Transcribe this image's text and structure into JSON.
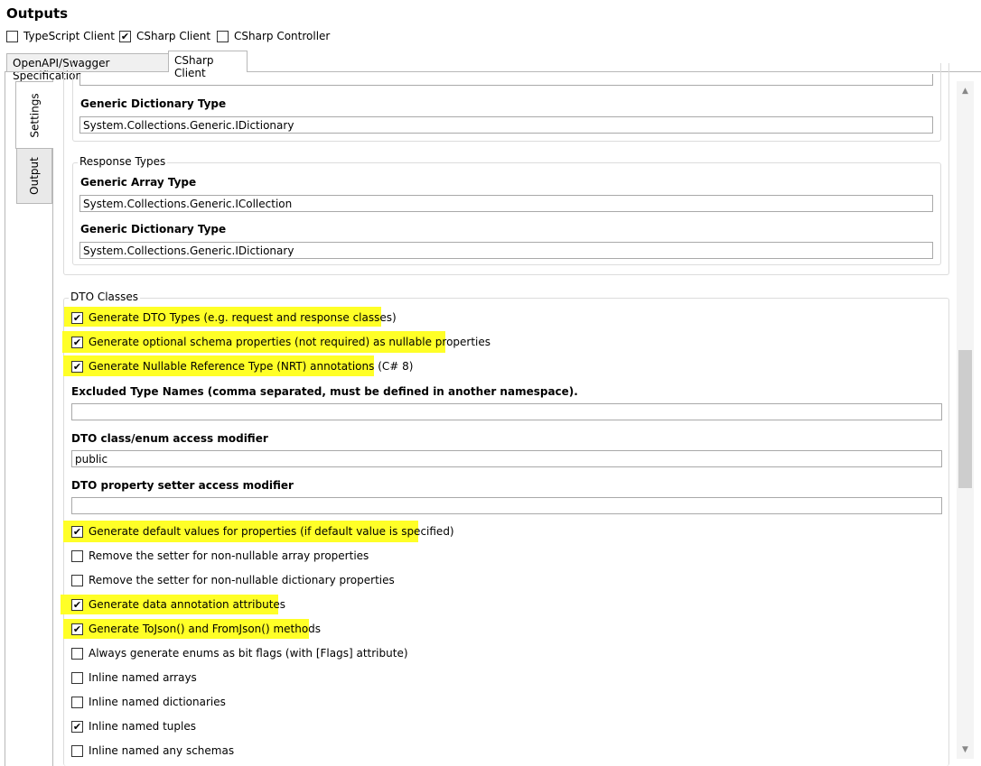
{
  "header": {
    "title": "Outputs",
    "outputs": [
      {
        "label": "TypeScript Client",
        "checked": false
      },
      {
        "label": "CSharp Client",
        "checked": true
      },
      {
        "label": "CSharp Controller",
        "checked": false
      }
    ]
  },
  "tabs": {
    "spec": "OpenAPI/Swagger Specification",
    "client": "CSharp Client",
    "active": "CSharp Client"
  },
  "side_tabs": {
    "settings": "Settings",
    "output": "Output",
    "active": "Settings"
  },
  "request_group": {
    "dict_label": "Generic Dictionary Type",
    "dict_value": "System.Collections.Generic.IDictionary"
  },
  "response_group": {
    "legend": "Response Types",
    "array_label": "Generic Array Type",
    "array_value": "System.Collections.Generic.ICollection",
    "dict_label": "Generic Dictionary Type",
    "dict_value": "System.Collections.Generic.IDictionary"
  },
  "dto": {
    "legend": "DTO Classes",
    "options_top": [
      {
        "label": "Generate DTO Types (e.g. request and response classes)",
        "checked": true,
        "highlighted": true
      },
      {
        "label": "Generate optional schema properties (not required) as nullable properties",
        "checked": true,
        "highlighted": true
      },
      {
        "label": "Generate Nullable Reference Type (NRT) annotations (C# 8)",
        "checked": true,
        "highlighted": true
      }
    ],
    "excluded_label": "Excluded Type Names (comma separated, must be defined in another namespace).",
    "excluded_value": "",
    "access_label": "DTO class/enum access modifier",
    "access_value": "public",
    "setter_label": "DTO property setter access modifier",
    "setter_value": "",
    "options_bottom": [
      {
        "label": "Generate default values for properties (if default value is specified)",
        "checked": true,
        "highlighted": true
      },
      {
        "label": "Remove the setter for non-nullable array properties",
        "checked": false,
        "highlighted": false
      },
      {
        "label": "Remove the setter for non-nullable dictionary properties",
        "checked": false,
        "highlighted": false
      },
      {
        "label": "Generate data annotation attributes",
        "checked": true,
        "highlighted": true
      },
      {
        "label": "Generate ToJson() and FromJson() methods",
        "checked": true,
        "highlighted": true
      },
      {
        "label": "Always generate enums as bit flags (with [Flags] attribute)",
        "checked": false,
        "highlighted": false
      },
      {
        "label": "Inline named arrays",
        "checked": false,
        "highlighted": false
      },
      {
        "label": "Inline named dictionaries",
        "checked": false,
        "highlighted": false
      },
      {
        "label": "Inline named tuples",
        "checked": true,
        "highlighted": false
      },
      {
        "label": "Inline named any schemas",
        "checked": false,
        "highlighted": false
      }
    ]
  },
  "colors": {
    "highlight": "#ffff27",
    "border": "#b8b8b8"
  }
}
